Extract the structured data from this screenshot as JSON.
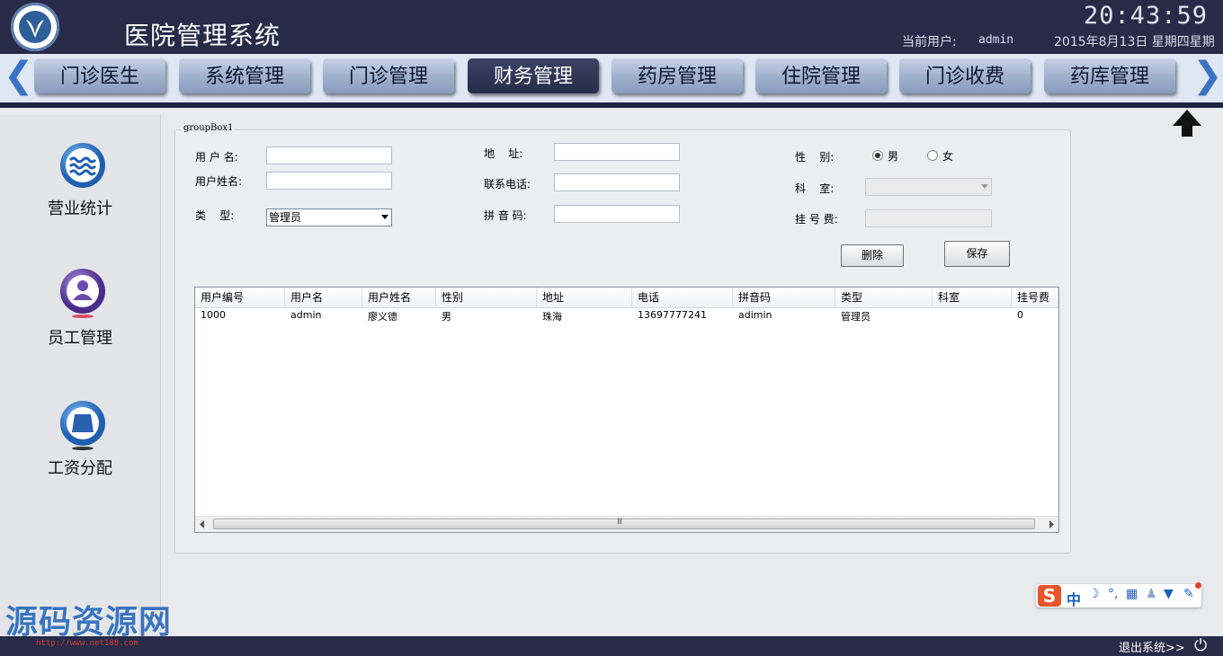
{
  "header": {
    "title": "医院管理系统",
    "clock": "20:43:59",
    "current_user_label": "当前用户:",
    "current_user": "admin",
    "date": "2015年8月13日 星期四星期"
  },
  "nav": {
    "tabs": [
      {
        "label": "门诊医生"
      },
      {
        "label": "系统管理"
      },
      {
        "label": "门诊管理"
      },
      {
        "label": "财务管理"
      },
      {
        "label": "药房管理"
      },
      {
        "label": "住院管理"
      },
      {
        "label": "门诊收费"
      },
      {
        "label": "药库管理"
      }
    ],
    "active_tab": "财务管理",
    "left_arrow": "❮",
    "right_arrow": "❯",
    "up_arrow": "🡅"
  },
  "sidebar": {
    "items": [
      {
        "label": "营业统计",
        "icon": "wave-icon",
        "color": "#2a73c9"
      },
      {
        "label": "员工管理",
        "icon": "user-icon",
        "color": "#6a4bb0"
      },
      {
        "label": "工资分配",
        "icon": "wallet-icon",
        "color": "#2a73c9"
      }
    ]
  },
  "form": {
    "group_title": "groupBox1",
    "username_label": "用 户 名:",
    "fullname_label": "用户姓名:",
    "type_label": "类    型:",
    "type_value": "管理员",
    "address_label": "地    址:",
    "phone_label": "联系电话:",
    "pinyin_label": "拼 音 码:",
    "gender_label": "性    别:",
    "gender_male": "男",
    "gender_female": "女",
    "gender_selected": "男",
    "dept_label": "科    室:",
    "fee_label": "挂 号 费:",
    "delete_button": "删除",
    "save_button": "保存"
  },
  "table": {
    "columns": [
      "用户编号",
      "用户名",
      "用户姓名",
      "性别",
      "地址",
      "电话",
      "拼音码",
      "类型",
      "科室",
      "挂号费"
    ],
    "rows": [
      [
        "1000",
        "admin",
        "廖义德",
        "男",
        "珠海",
        "13697777241",
        "adimin",
        "管理员",
        "",
        "0"
      ]
    ],
    "scroll_grip": "Ⅲ"
  },
  "footer": {
    "exit_label": "退出系统>>",
    "power_icon": "⏻"
  },
  "overlay": {
    "watermark": "源码资源网",
    "watermark_url": "http://www.net188.com",
    "ime_text": "中"
  }
}
